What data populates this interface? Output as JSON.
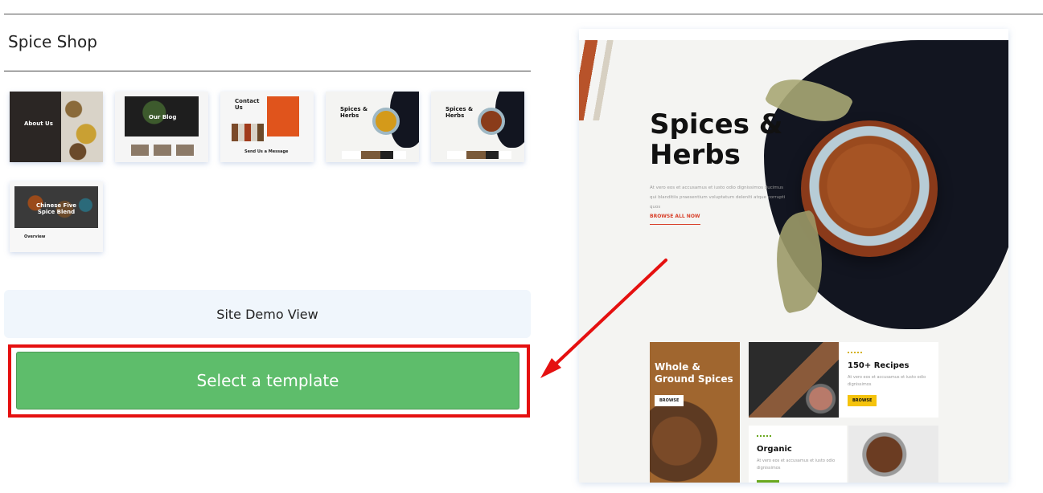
{
  "header": {
    "title": "Spice Shop"
  },
  "thumbnails": [
    {
      "label": "About Us"
    },
    {
      "label": "Our Blog"
    },
    {
      "label": "Contact Us",
      "sub": "Send Us a Message"
    },
    {
      "label": "Spices & Herbs"
    },
    {
      "label": "Spices & Herbs"
    },
    {
      "label": "Chinese Five Spice Blend",
      "sub": "Overview"
    }
  ],
  "actions": {
    "demo_label": "Site Demo View",
    "select_label": "Select a template"
  },
  "preview": {
    "title_line1": "Spices &",
    "title_line2": "Herbs",
    "body": "At vero eos et accusamus et iusto odio dignissimos ducimus qui blanditiis praesentium voluptatum deleniti atque corrupti quos",
    "link": "BROWSE ALL NOW",
    "cards": {
      "whole": {
        "title_line1": "Whole &",
        "title_line2": "Ground Spices",
        "button": "BROWSE"
      },
      "recipes": {
        "title": "150+ Recipes",
        "text": "At vero eos et accusamus et iusto odio dignissimos",
        "button": "BROWSE"
      },
      "organic": {
        "title": "Organic",
        "text": "At vero eos et accusamus et iusto odio dignissimos"
      }
    }
  },
  "colors": {
    "select_button": "#5ebd6b",
    "highlight_frame": "#e51010",
    "demo_box": "#f0f6fc",
    "arrow": "#e51010"
  }
}
